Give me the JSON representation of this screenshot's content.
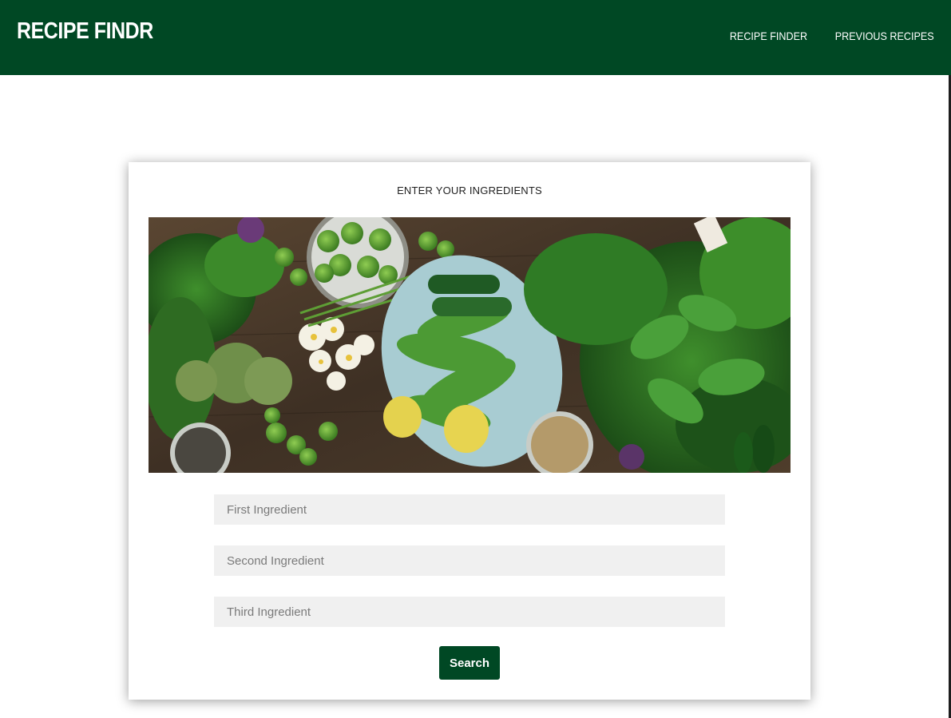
{
  "navbar": {
    "brand": "RECIPE FINDR",
    "links": [
      "RECIPE FINDER",
      "PREVIOUS RECIPES"
    ]
  },
  "card": {
    "title": "ENTER YOUR INGREDIENTS",
    "hero_image": "fresh-green-vegetables-photo",
    "inputs": [
      {
        "placeholder": "First Ingredient",
        "value": ""
      },
      {
        "placeholder": "Second Ingredient",
        "value": ""
      },
      {
        "placeholder": "Third Ingredient",
        "value": ""
      }
    ],
    "search_label": "Search"
  },
  "colors": {
    "primary": "#004824",
    "input_bg": "#f0f0f0",
    "page_bg": "#ffffff"
  }
}
